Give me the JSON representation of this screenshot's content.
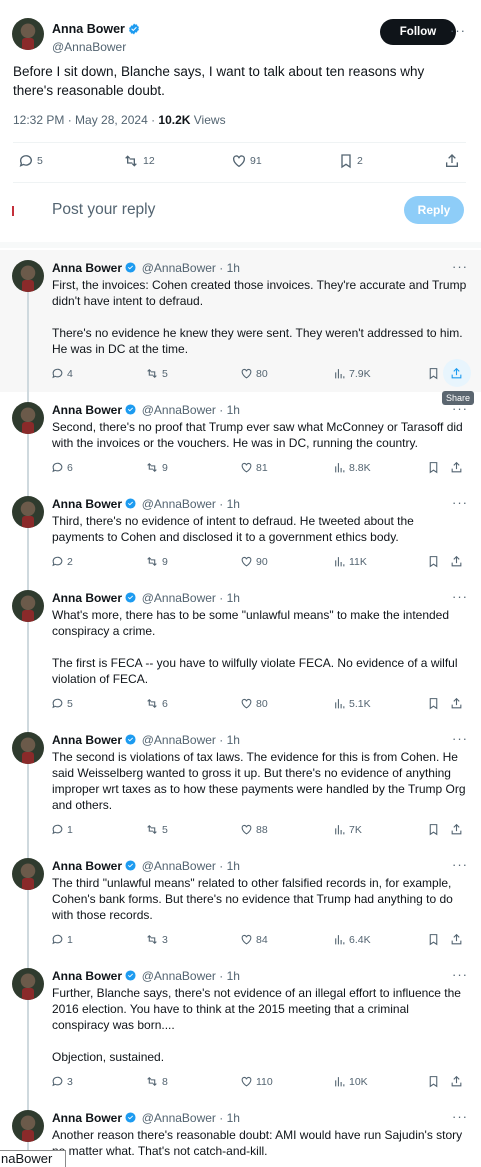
{
  "main_tweet": {
    "name": "Anna Bower",
    "handle": "@AnnaBower",
    "follow_label": "Follow",
    "text": "Before I sit down, Blanche says, I want to talk about ten reasons why there's reasonable doubt.",
    "time": "12:32 PM · May 28, 2024 · ",
    "views_count": "10.2K",
    "views_label": " Views",
    "stats": {
      "replies": "5",
      "reposts": "12",
      "likes": "91",
      "bookmarks": "2"
    }
  },
  "reply_box": {
    "placeholder": "Post your reply",
    "button_label": "Reply"
  },
  "tooltip": "Share",
  "replies": [
    {
      "name": "Anna Bower",
      "handle": "@AnnaBower · 1h",
      "paragraphs": [
        "First, the invoices: Cohen created those invoices. They're accurate and Trump didn't have intent to defraud.",
        "There's no evidence he knew they were sent. They weren't addressed to him. He was in DC at the time."
      ],
      "replies": "4",
      "reposts": "5",
      "likes": "80",
      "views": "7.9K"
    },
    {
      "name": "Anna Bower",
      "handle": "@AnnaBower · 1h",
      "paragraphs": [
        "Second, there's no proof that Trump ever saw what McConney or Tarasoff did with the invoices or the vouchers. He was in DC, running the country."
      ],
      "replies": "6",
      "reposts": "9",
      "likes": "81",
      "views": "8.8K"
    },
    {
      "name": "Anna Bower",
      "handle": "@AnnaBower · 1h",
      "paragraphs": [
        "Third, there's no evidence of intent to defraud. He tweeted about the payments to Cohen and disclosed it to a government ethics body."
      ],
      "replies": "2",
      "reposts": "9",
      "likes": "90",
      "views": "11K"
    },
    {
      "name": "Anna Bower",
      "handle": "@AnnaBower · 1h",
      "paragraphs": [
        "What's more, there has to be some \"unlawful means\" to make the intended conspiracy a crime.",
        "The first is FECA -- you have to wilfully violate FECA. No evidence of a wilful violation of FECA."
      ],
      "replies": "5",
      "reposts": "6",
      "likes": "80",
      "views": "5.1K"
    },
    {
      "name": "Anna Bower",
      "handle": "@AnnaBower · 1h",
      "paragraphs": [
        "The second is violations of tax laws. The evidence for this is from Cohen. He said Weisselberg wanted to gross it up. But there's no evidence of anything improper wrt taxes as to how these payments were handled by the Trump Org and others."
      ],
      "replies": "1",
      "reposts": "5",
      "likes": "88",
      "views": "7K"
    },
    {
      "name": "Anna Bower",
      "handle": "@AnnaBower · 1h",
      "paragraphs": [
        "The third \"unlawful means\" related to other falsified records in, for example, Cohen's bank forms. But there's no evidence that Trump had anything to do with those records."
      ],
      "replies": "1",
      "reposts": "3",
      "likes": "84",
      "views": "6.4K"
    },
    {
      "name": "Anna Bower",
      "handle": "@AnnaBower · 1h",
      "paragraphs": [
        "Further, Blanche says, there's not evidence of an illegal effort to influence the 2016 election. You have to think at the 2015 meeting that a criminal conspiracy was born....",
        "Objection, sustained."
      ],
      "replies": "3",
      "reposts": "8",
      "likes": "110",
      "views": "10K"
    },
    {
      "name": "Anna Bower",
      "handle": "@AnnaBower · 1h",
      "paragraphs": [
        "Another reason there's reasonable doubt: AMI would have run Sajudin's story no matter what. That's not catch-and-kill."
      ]
    }
  ],
  "bottom_tab": "naBower",
  "colors": {
    "accent": "#1d9bf0",
    "reply_button": "#8ecdf8",
    "text": "#0f1419",
    "muted": "#536471"
  }
}
